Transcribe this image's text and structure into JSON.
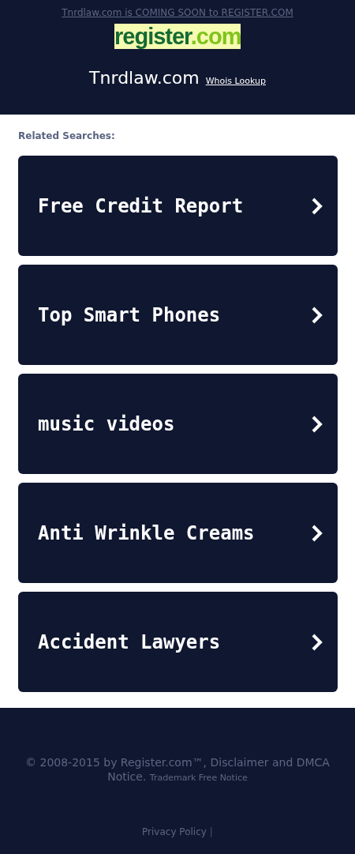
{
  "header": {
    "notice_link": "Tnrdlaw.com is COMING SOON to REGISTER.COM",
    "logo": {
      "name": "register",
      "suffix": ".com"
    },
    "domain": "Tnrdlaw.com",
    "whois_link": "Whois Lookup"
  },
  "related": {
    "heading": "Related Searches:",
    "items": [
      {
        "label": "Free Credit Report"
      },
      {
        "label": "Top Smart Phones"
      },
      {
        "label": "music videos"
      },
      {
        "label": "Anti Wrinkle Creams"
      },
      {
        "label": "Accident Lawyers"
      }
    ]
  },
  "footer": {
    "copyright": "© 2008-2015 by Register.com™, Disclaimer and DMCA Notice.",
    "trademark_link": "Trademark Free Notice",
    "privacy_link": "Privacy Policy",
    "separator": "|"
  }
}
